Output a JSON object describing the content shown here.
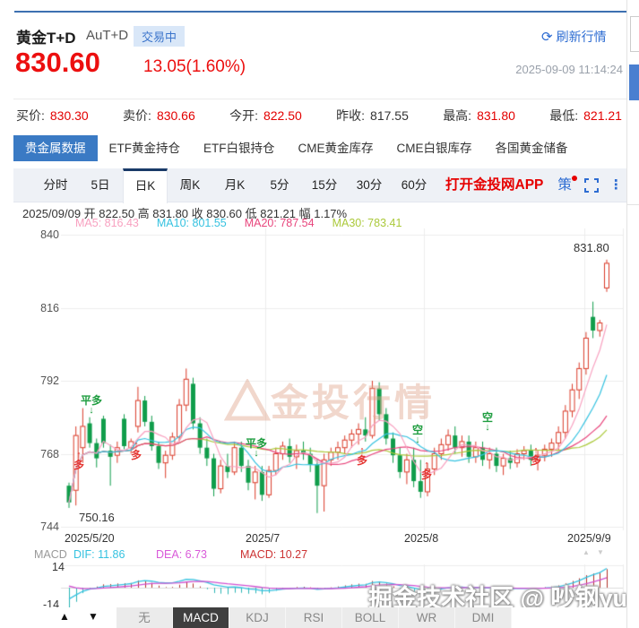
{
  "header": {
    "title": "黄金T+D",
    "subtitle": "AuT+D",
    "status_badge": "交易中",
    "refresh_label": "刷新行情",
    "price": "830.60",
    "change": "13.05(1.60%)",
    "timestamp": "2025-09-09 11:14:24"
  },
  "icons": {
    "refresh": "⟳",
    "more": "⋮",
    "up_tri": "▲",
    "down_tri": "▼",
    "arrow_up": "↑",
    "arrow_down": "↓"
  },
  "quote_fields": [
    {
      "label": "买价:",
      "value": "830.30",
      "color": "#e30000"
    },
    {
      "label": "卖价:",
      "value": "830.66",
      "color": "#e30000"
    },
    {
      "label": "今开:",
      "value": "822.50",
      "color": "#e30000"
    },
    {
      "label": "昨收:",
      "value": "817.55",
      "color": "#333333"
    },
    {
      "label": "最高:",
      "value": "831.80",
      "color": "#e30000"
    },
    {
      "label": "最低:",
      "value": "821.21",
      "color": "#e30000"
    }
  ],
  "data_tabs": [
    {
      "label": "贵金属数据",
      "active": true
    },
    {
      "label": "ETF黄金持仓",
      "active": false
    },
    {
      "label": "ETF白银持仓",
      "active": false
    },
    {
      "label": "CME黄金库存",
      "active": false
    },
    {
      "label": "CME白银库存",
      "active": false
    },
    {
      "label": "各国黄金储备",
      "active": false
    }
  ],
  "period_tabs": [
    {
      "label": "分时",
      "active": false
    },
    {
      "label": "5日",
      "active": false
    },
    {
      "label": "日K",
      "active": true
    },
    {
      "label": "周K",
      "active": false
    },
    {
      "label": "月K",
      "active": false
    },
    {
      "label": "5分",
      "active": false
    },
    {
      "label": "15分",
      "active": false
    },
    {
      "label": "30分",
      "active": false
    },
    {
      "label": "60分",
      "active": false
    }
  ],
  "toolbar": {
    "promo": "打开金投网APP",
    "strategy": "策"
  },
  "ohlc_line": "2025/09/09  开 822.50  高 831.80  收 830.60  低 821.21  幅 1.17%",
  "ma_labels": [
    {
      "text": "MA5: 816.43",
      "color": "#f8a1c0"
    },
    {
      "text": "MA10: 801.55",
      "color": "#35c2e0"
    },
    {
      "text": "MA20: 787.54",
      "color": "#e8457c"
    },
    {
      "text": "MA30: 783.41",
      "color": "#abc93a"
    }
  ],
  "macd_info": [
    {
      "text": "MACD",
      "color": "#999999"
    },
    {
      "text": "DIF: 11.86",
      "color": "#35c2e0"
    },
    {
      "text": "DEA: 6.73",
      "color": "#d959d9"
    },
    {
      "text": "MACD: 10.27",
      "color": "#cc3333"
    }
  ],
  "indicator_tabs": [
    {
      "label": "无",
      "active": false
    },
    {
      "label": "MACD",
      "active": true
    },
    {
      "label": "KDJ",
      "active": false
    },
    {
      "label": "RSI",
      "active": false
    },
    {
      "label": "BOLL",
      "active": false
    },
    {
      "label": "WR",
      "active": false
    },
    {
      "label": "DMI",
      "active": false
    }
  ],
  "watermark_center": "金投行情",
  "watermark_user": "掘金技术社区 @ 吵钢yu",
  "chart_data": {
    "type": "candlestick",
    "title": "黄金T+D 日K",
    "y_ticks": [
      840,
      816,
      792,
      768,
      744
    ],
    "y_tick_labels": [
      {
        "text": "840",
        "left": 40,
        "top": 255
      },
      {
        "text": "816",
        "left": 40,
        "top": 337
      },
      {
        "text": "792",
        "left": 40,
        "top": 418
      },
      {
        "text": "768",
        "left": 40,
        "top": 500
      },
      {
        "text": "744",
        "left": 40,
        "top": 581
      }
    ],
    "x_labels": [
      {
        "text": "2025/5/20",
        "left": 72,
        "top": 594
      },
      {
        "text": "2025/7",
        "left": 274,
        "top": 594
      },
      {
        "text": "2025/8",
        "left": 451,
        "top": 594
      },
      {
        "text": "2025/9/9",
        "left": 633,
        "top": 594
      }
    ],
    "v_grid_x": [
      296,
      473,
      652,
      695
    ],
    "price_labels": [
      {
        "text": "750.16",
        "left": 88,
        "top": 570
      },
      {
        "text": "831.80",
        "left": 640,
        "top": 269
      }
    ],
    "annotations": [
      {
        "text": "平多",
        "dir": "down",
        "color": "#1f9d40",
        "left": 88,
        "top": 441
      },
      {
        "text": "多",
        "dir": "up",
        "color": "#e53935",
        "left": 74,
        "top": 503
      },
      {
        "text": "多",
        "dir": "up",
        "color": "#e53935",
        "left": 138,
        "top": 492
      },
      {
        "text": "平多",
        "dir": "down",
        "color": "#1f9d40",
        "left": 272,
        "top": 489
      },
      {
        "text": "多",
        "dir": "up",
        "color": "#e53935",
        "left": 390,
        "top": 498
      },
      {
        "text": "空",
        "dir": "down",
        "color": "#1f9d40",
        "left": 452,
        "top": 474
      },
      {
        "text": "多",
        "dir": "up",
        "color": "#e53935",
        "left": 462,
        "top": 514
      },
      {
        "text": "空",
        "dir": "down",
        "color": "#1f9d40",
        "left": 530,
        "top": 460
      },
      {
        "text": "多",
        "dir": "up",
        "color": "#e53935",
        "left": 584,
        "top": 498
      }
    ],
    "colors": {
      "up": "#da3a28",
      "down": "#109d4b",
      "grid": "#ececec",
      "ma5": "#f8a1c0",
      "ma10": "#35c2e0",
      "ma20": "#e8457c",
      "ma30": "#abc93a",
      "dif": "#35c2e0",
      "dea": "#d050d0",
      "hist_pos": "#b03028",
      "hist_neg": "#2ab5b5"
    },
    "ma_periods": [
      5,
      10,
      20,
      30
    ],
    "candles": [
      [
        757.5,
        758.5,
        750.2,
        752
      ],
      [
        756,
        777,
        751,
        774
      ],
      [
        770,
        783,
        765,
        777
      ],
      [
        778,
        780,
        770,
        771.5
      ],
      [
        771.5,
        773,
        763.5,
        766.5
      ],
      [
        779.5,
        780.5,
        770,
        771.5
      ],
      [
        769,
        771,
        757.5,
        767
      ],
      [
        767.5,
        772,
        765,
        770
      ],
      [
        779.5,
        781,
        769.5,
        770.5
      ],
      [
        770,
        773,
        768,
        772
      ],
      [
        777,
        790,
        775,
        785.5
      ],
      [
        785.5,
        787,
        777,
        778.5
      ],
      [
        778.5,
        780.5,
        769,
        770.5
      ],
      [
        770.5,
        772,
        763,
        765
      ],
      [
        765,
        769,
        760,
        767.5
      ],
      [
        767.5,
        775,
        766,
        773.5
      ],
      [
        773.5,
        786,
        772,
        784
      ],
      [
        784,
        796,
        782,
        792.5
      ],
      [
        791,
        793,
        776,
        778
      ],
      [
        778,
        780,
        768,
        770
      ],
      [
        770,
        773,
        764,
        766.5
      ],
      [
        766.5,
        768,
        754,
        756.5
      ],
      [
        756.5,
        766,
        755,
        764
      ],
      [
        764,
        768,
        760,
        762
      ],
      [
        762,
        772,
        761,
        770
      ],
      [
        770,
        772,
        762,
        764
      ],
      [
        764,
        766,
        756,
        758.5
      ],
      [
        758.5,
        764,
        753,
        762
      ],
      [
        762,
        764,
        752.5,
        754.5
      ],
      [
        754.5,
        764,
        753.5,
        762.5
      ],
      [
        762.5,
        770,
        761,
        768
      ],
      [
        768,
        772,
        766,
        770.5
      ],
      [
        770.5,
        773,
        765,
        767
      ],
      [
        767,
        771,
        763,
        769
      ],
      [
        769,
        772,
        766,
        768
      ],
      [
        768,
        770,
        762,
        764.5
      ],
      [
        764.5,
        766,
        748.5,
        757.5
      ],
      [
        757.5,
        768,
        749,
        766
      ],
      [
        766,
        770,
        764,
        768.5
      ],
      [
        768.5,
        772,
        766,
        770
      ],
      [
        770,
        774,
        768,
        772.5
      ],
      [
        772.5,
        776,
        770,
        774.5
      ],
      [
        774.5,
        778,
        771,
        776
      ],
      [
        776,
        780,
        772,
        774
      ],
      [
        774,
        792,
        773,
        789.5
      ],
      [
        789.5,
        791.5,
        779,
        781
      ],
      [
        781,
        783,
        771,
        773
      ],
      [
        773,
        775,
        765,
        767.5
      ],
      [
        767.5,
        770,
        760,
        762
      ],
      [
        762,
        768,
        758,
        766
      ],
      [
        766,
        770,
        757,
        759
      ],
      [
        759,
        766,
        753.5,
        755.5
      ],
      [
        755.5,
        765,
        754,
        763
      ],
      [
        763,
        770,
        761,
        768
      ],
      [
        768,
        773,
        766,
        771
      ],
      [
        771,
        776,
        769,
        774
      ],
      [
        774,
        777,
        768,
        770
      ],
      [
        770,
        774,
        767,
        772
      ],
      [
        772,
        774,
        765,
        767
      ],
      [
        767,
        772,
        765,
        770
      ],
      [
        770,
        772,
        764,
        766
      ],
      [
        766,
        770,
        763,
        768
      ],
      [
        768,
        770,
        762,
        764
      ],
      [
        764,
        768,
        761,
        766.5
      ],
      [
        766.5,
        769,
        763,
        765
      ],
      [
        765,
        769.5,
        763.5,
        768
      ],
      [
        768,
        770.5,
        766,
        769
      ],
      [
        769,
        771,
        764,
        766
      ],
      [
        766,
        769,
        762.5,
        767.5
      ],
      [
        767.5,
        771,
        765.5,
        769.5
      ],
      [
        769.5,
        773,
        767,
        771.5
      ],
      [
        771.5,
        777,
        769,
        775
      ],
      [
        775,
        784,
        773,
        782
      ],
      [
        782,
        791,
        780,
        789
      ],
      [
        789,
        798,
        786,
        796
      ],
      [
        796,
        808,
        794,
        806
      ],
      [
        813,
        818,
        806,
        808.5
      ],
      [
        808.5,
        812,
        806.5,
        811
      ],
      [
        822.5,
        831.8,
        821.21,
        830.6
      ]
    ],
    "macd": {
      "y_tick_labels": [
        {
          "text": "14",
          "left": 58,
          "top": 626
        },
        {
          "text": "-14",
          "left": 48,
          "top": 668
        }
      ],
      "dif_value": 11.86,
      "dea_value": 6.73,
      "macd_value": 10.27
    }
  }
}
